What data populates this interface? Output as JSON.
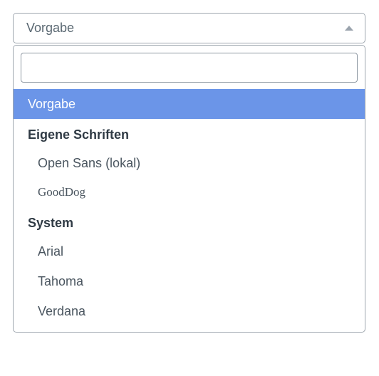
{
  "select": {
    "current": "Vorgabe",
    "search_placeholder": "",
    "default_option": "Vorgabe",
    "groups": [
      {
        "label": "Eigene Schriften",
        "options": [
          "Open Sans (lokal)",
          "GoodDog"
        ]
      },
      {
        "label": "System",
        "options": [
          "Arial",
          "Tahoma",
          "Verdana"
        ]
      }
    ]
  }
}
